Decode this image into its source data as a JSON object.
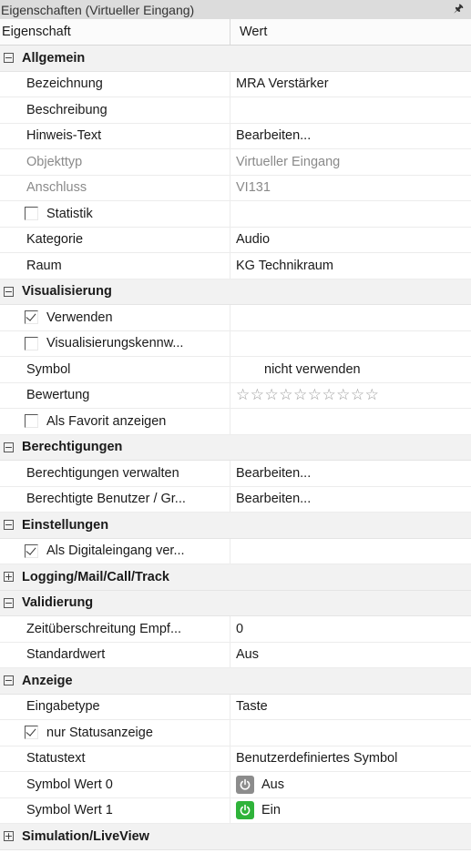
{
  "window": {
    "title": "Eigenschaften (Virtueller Eingang)",
    "pin_icon": "pin-icon"
  },
  "header": {
    "col1": "Eigenschaft",
    "col2": "Wert"
  },
  "categories": {
    "allgemein": "Allgemein",
    "visualisierung": "Visualisierung",
    "berechtigungen": "Berechtigungen",
    "einstellungen": "Einstellungen",
    "logging": "Logging/Mail/Call/Track",
    "validierung": "Validierung",
    "anzeige": "Anzeige",
    "simulation": "Simulation/LiveView"
  },
  "allgemein": {
    "bezeichnung": {
      "key": "Bezeichnung",
      "value": "MRA Verstärker"
    },
    "beschreibung": {
      "key": "Beschreibung",
      "value": ""
    },
    "hinweis": {
      "key": "Hinweis-Text",
      "value": "Bearbeiten..."
    },
    "objekttyp": {
      "key": "Objekttyp",
      "value": "Virtueller Eingang"
    },
    "anschluss": {
      "key": "Anschluss",
      "value": "VI131"
    },
    "statistik": {
      "key": "Statistik",
      "checked": false
    },
    "kategorie": {
      "key": "Kategorie",
      "value": "Audio"
    },
    "raum": {
      "key": "Raum",
      "value": "KG Technikraum"
    }
  },
  "visualisierung": {
    "verwenden": {
      "key": "Verwenden",
      "checked": true
    },
    "kennwort": {
      "key": "Visualisierungskennw...",
      "checked": false
    },
    "symbol": {
      "key": "Symbol",
      "value": "nicht verwenden"
    },
    "bewertung": {
      "key": "Bewertung",
      "stars": "☆☆☆☆☆☆☆☆☆☆",
      "rating": 0,
      "max": 10
    },
    "favorit": {
      "key": "Als Favorit anzeigen",
      "checked": false
    }
  },
  "berechtigungen": {
    "verwalten": {
      "key": "Berechtigungen verwalten",
      "value": "Bearbeiten..."
    },
    "benutzer": {
      "key": "Berechtigte Benutzer / Gr...",
      "value": "Bearbeiten..."
    }
  },
  "einstellungen": {
    "digital": {
      "key": "Als Digitaleingang ver...",
      "checked": true
    }
  },
  "validierung": {
    "zeit": {
      "key": "Zeitüberschreitung Empf...",
      "value": "0"
    },
    "standard": {
      "key": "Standardwert",
      "value": "Aus"
    }
  },
  "anzeige": {
    "eingabetype": {
      "key": "Eingabetype",
      "value": "Taste"
    },
    "nurstatus": {
      "key": "nur Statusanzeige",
      "checked": true
    },
    "statustext": {
      "key": "Statustext",
      "value": "Benutzerdefiniertes Symbol"
    },
    "wert0": {
      "key": "Symbol Wert 0",
      "value": "Aus",
      "icon": "power-icon-gray",
      "color": "#8c8c8c"
    },
    "wert1": {
      "key": "Symbol Wert 1",
      "value": "Ein",
      "icon": "power-icon-green",
      "color": "#2fb33a"
    }
  },
  "colors": {
    "category_bg": "#f2f2f2",
    "disabled_text": "#8a8a8a",
    "titlebar_bg": "#dcdcdc"
  }
}
